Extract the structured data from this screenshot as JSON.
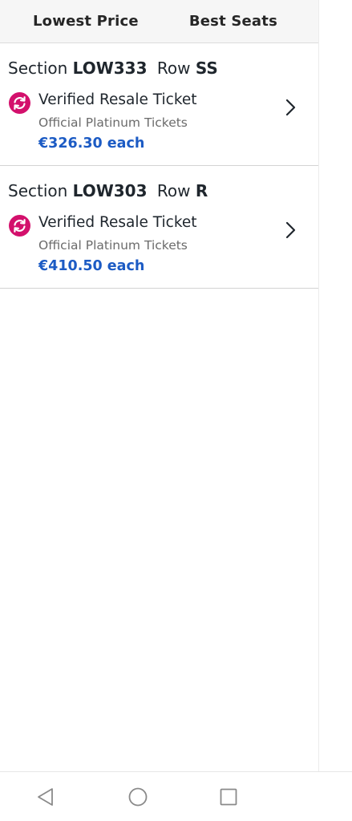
{
  "tabs": [
    {
      "label": "Lowest Price"
    },
    {
      "label": "Best Seats"
    }
  ],
  "listings": [
    {
      "section_prefix": "Section",
      "section": "LOW333",
      "row_prefix": "Row",
      "row": "SS",
      "ticket_type": "Verified Resale Ticket",
      "seller": "Official Platinum Tickets",
      "price": "€326.30 each"
    },
    {
      "section_prefix": "Section",
      "section": "LOW303",
      "row_prefix": "Row",
      "row": "R",
      "ticket_type": "Verified Resale Ticket",
      "seller": "Official Platinum Tickets",
      "price": "€410.50 each"
    }
  ],
  "colors": {
    "accent_price": "#1c5bc4",
    "resale_icon": "#d3106c"
  },
  "icons": {
    "resale": "resale-icon",
    "chevron": "chevron-right-icon",
    "nav_back": "back-triangle-icon",
    "nav_home": "home-circle-icon",
    "nav_recent": "recent-square-icon"
  }
}
